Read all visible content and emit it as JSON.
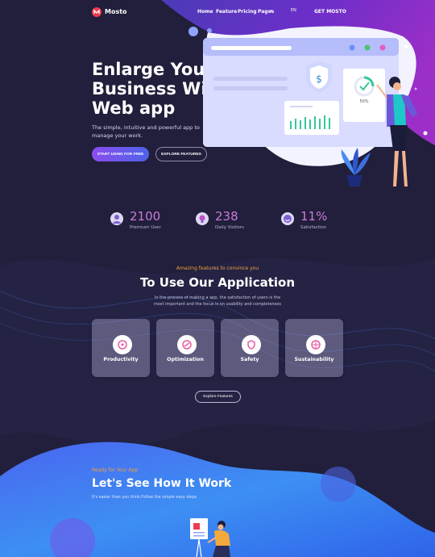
{
  "brand": {
    "name": "Mosto"
  },
  "nav": {
    "items": [
      "Home",
      "Feature",
      "Pricing",
      "Pages"
    ],
    "lang": "EN",
    "cta": "GET MOSTO"
  },
  "hero": {
    "title_lines": [
      "Enlarge Your",
      "Business With",
      "Web app"
    ],
    "subtitle": "The simple, intuitive and powerful app to manage your work.",
    "primary_button": "START USING FOR FREE",
    "secondary_button": "EXPLORE FEATURES",
    "dashboard_percent": "50%"
  },
  "stats": [
    {
      "value": "2100",
      "label": "Premium User",
      "icon": "user-icon"
    },
    {
      "value": "238",
      "label": "Daily Visitors",
      "icon": "bulb-icon"
    },
    {
      "value": "11%",
      "label": "Satisfaction",
      "icon": "smile-icon"
    }
  ],
  "features": {
    "kicker": "Amazing features to convince you",
    "title": "To Use Our Application",
    "description": "In the process of making a app, the satisfaction of users is the most important and the focus is on usability and completeness",
    "cards": [
      {
        "label": "Productivity",
        "icon": "productivity-icon"
      },
      {
        "label": "Optimization",
        "icon": "optimization-icon"
      },
      {
        "label": "Safety",
        "icon": "safety-icon"
      },
      {
        "label": "Sustainability",
        "icon": "sustainability-icon"
      }
    ],
    "button": "Explore Features"
  },
  "how": {
    "kicker": "Ready for Your App",
    "title": "Let's See How It Work",
    "subtitle": "It's easier than you think.Follow the simple easy steps"
  },
  "colors": {
    "background": "#211f3b",
    "accent_orange": "#f7a13b",
    "accent_pink": "#c97ad9",
    "brand_red": "#ee3c4f",
    "gradient_start": "#8b4dee",
    "gradient_end": "#4d63e8"
  }
}
